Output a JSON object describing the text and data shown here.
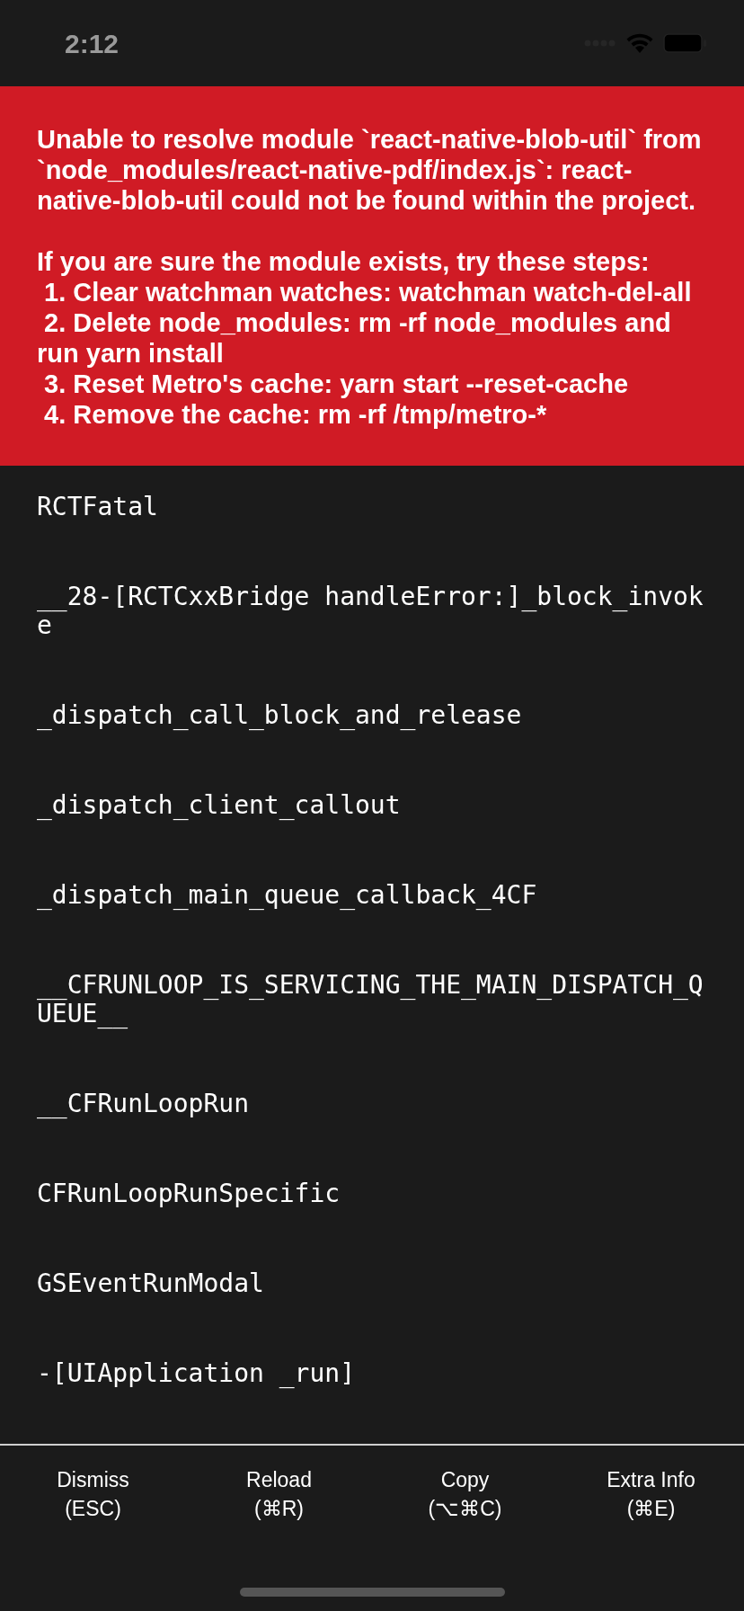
{
  "status_bar": {
    "time": "2:12"
  },
  "error": {
    "message": "Unable to resolve module `react-native-blob-util` from `node_modules/react-native-pdf/index.js`: react-native-blob-util could not be found within the project.\n\nIf you are sure the module exists, try these steps:\n 1. Clear watchman watches: watchman watch-del-all\n 2. Delete node_modules: rm -rf node_modules and run yarn install\n 3. Reset Metro's cache: yarn start --reset-cache\n 4. Remove the cache: rm -rf /tmp/metro-*"
  },
  "stack_trace": [
    "RCTFatal",
    "__28-[RCTCxxBridge handleError:]_block_invoke",
    "_dispatch_call_block_and_release",
    "_dispatch_client_callout",
    "_dispatch_main_queue_callback_4CF",
    "__CFRUNLOOP_IS_SERVICING_THE_MAIN_DISPATCH_QUEUE__",
    "__CFRunLoopRun",
    "CFRunLoopRunSpecific",
    "GSEventRunModal",
    "-[UIApplication _run]"
  ],
  "buttons": [
    {
      "label": "Dismiss",
      "shortcut": "(ESC)"
    },
    {
      "label": "Reload",
      "shortcut": "(⌘R)"
    },
    {
      "label": "Copy",
      "shortcut": "(⌥⌘C)"
    },
    {
      "label": "Extra Info",
      "shortcut": "(⌘E)"
    }
  ]
}
